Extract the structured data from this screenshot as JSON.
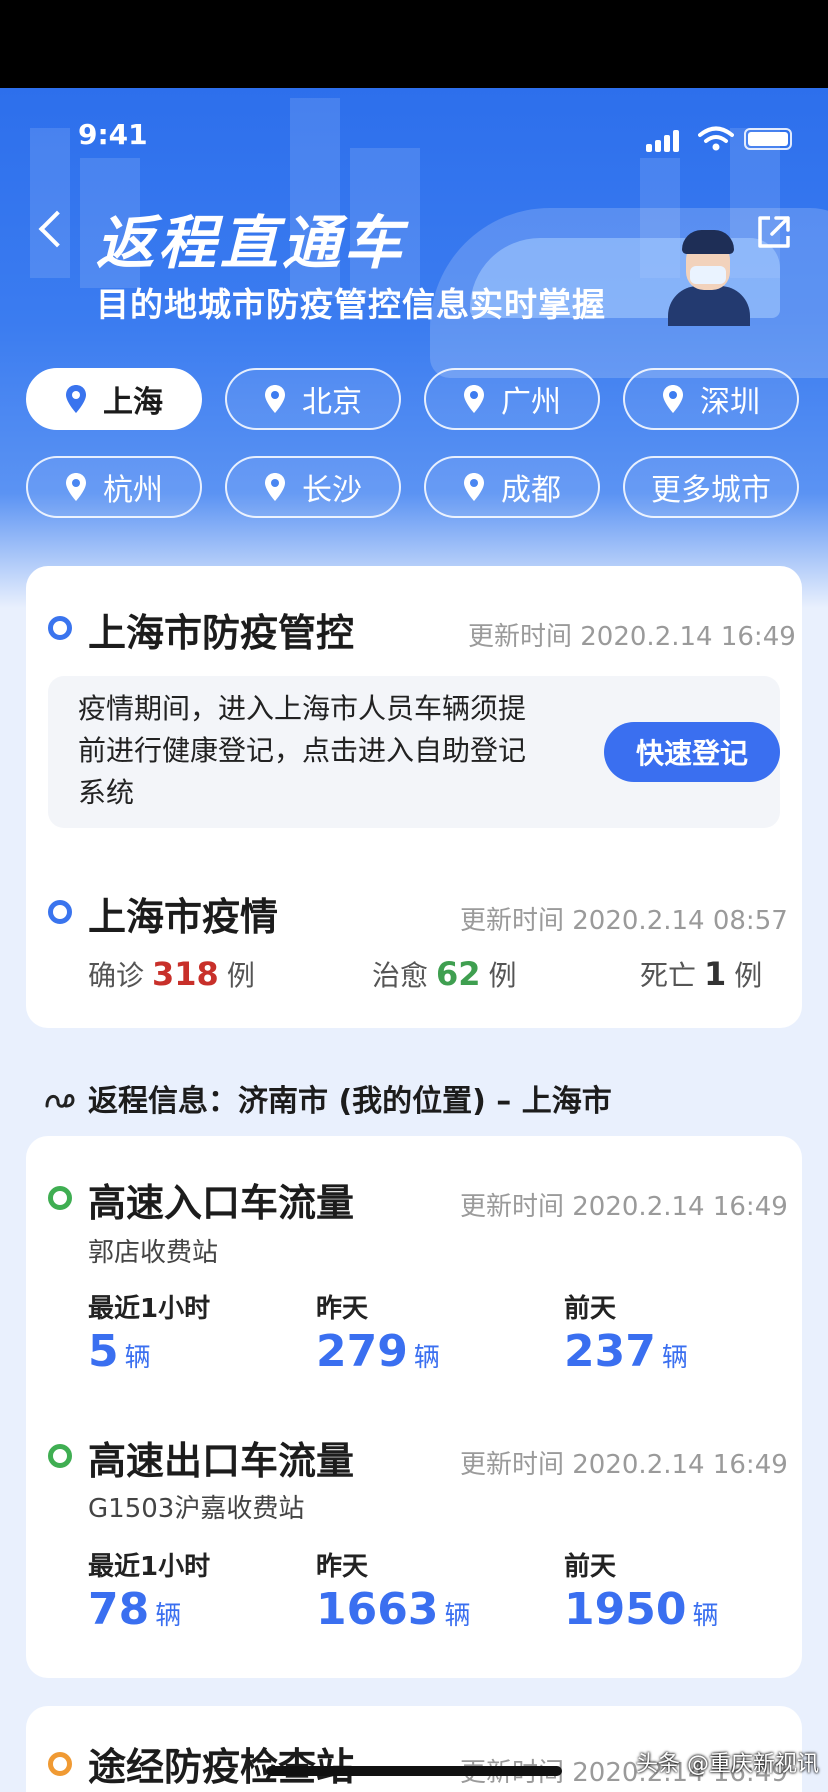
{
  "status_bar": {
    "time": "9:41"
  },
  "header": {
    "title": "返程直通车",
    "subtitle": "目的地城市防疫管控信息实时掌握"
  },
  "cities": [
    {
      "label": "上海",
      "active": true
    },
    {
      "label": "北京",
      "active": false
    },
    {
      "label": "广州",
      "active": false
    },
    {
      "label": "深圳",
      "active": false
    },
    {
      "label": "杭州",
      "active": false
    },
    {
      "label": "长沙",
      "active": false
    },
    {
      "label": "成都",
      "active": false
    }
  ],
  "more_cities_label": "更多城市",
  "control": {
    "title": "上海市防疫管控",
    "updated": "更新时间 2020.2.14 16:49",
    "notice": "疫情期间，进入上海市人员车辆须提前进行健康登记，点击进入自助登记系统",
    "button": "快速登记"
  },
  "epidemic": {
    "title": "上海市疫情",
    "updated": "更新时间 2020.2.14 08:57",
    "confirmed_label": "确诊",
    "confirmed": "318",
    "cured_label": "治愈",
    "cured": "62",
    "death_label": "死亡",
    "death": "1",
    "unit": "例"
  },
  "route": {
    "text": "返程信息：济南市 (我的位置) – 上海市"
  },
  "entry_flow": {
    "title": "高速入口车流量",
    "updated": "更新时间 2020.2.14 16:49",
    "station": "郭店收费站",
    "labels": [
      "最近1小时",
      "昨天",
      "前天"
    ],
    "values": [
      "5",
      "279",
      "237"
    ],
    "unit": "辆"
  },
  "exit_flow": {
    "title": "高速出口车流量",
    "updated": "更新时间 2020.2.14 16:49",
    "station": "G1503沪嘉收费站",
    "labels": [
      "最近1小时",
      "昨天",
      "前天"
    ],
    "values": [
      "78",
      "1663",
      "1950"
    ],
    "unit": "辆"
  },
  "checkpoints": {
    "title": "途经防疫检查站",
    "updated": "更新时间 2020.2.14 16:49"
  },
  "watermark": "头条 @重庆新视讯"
}
